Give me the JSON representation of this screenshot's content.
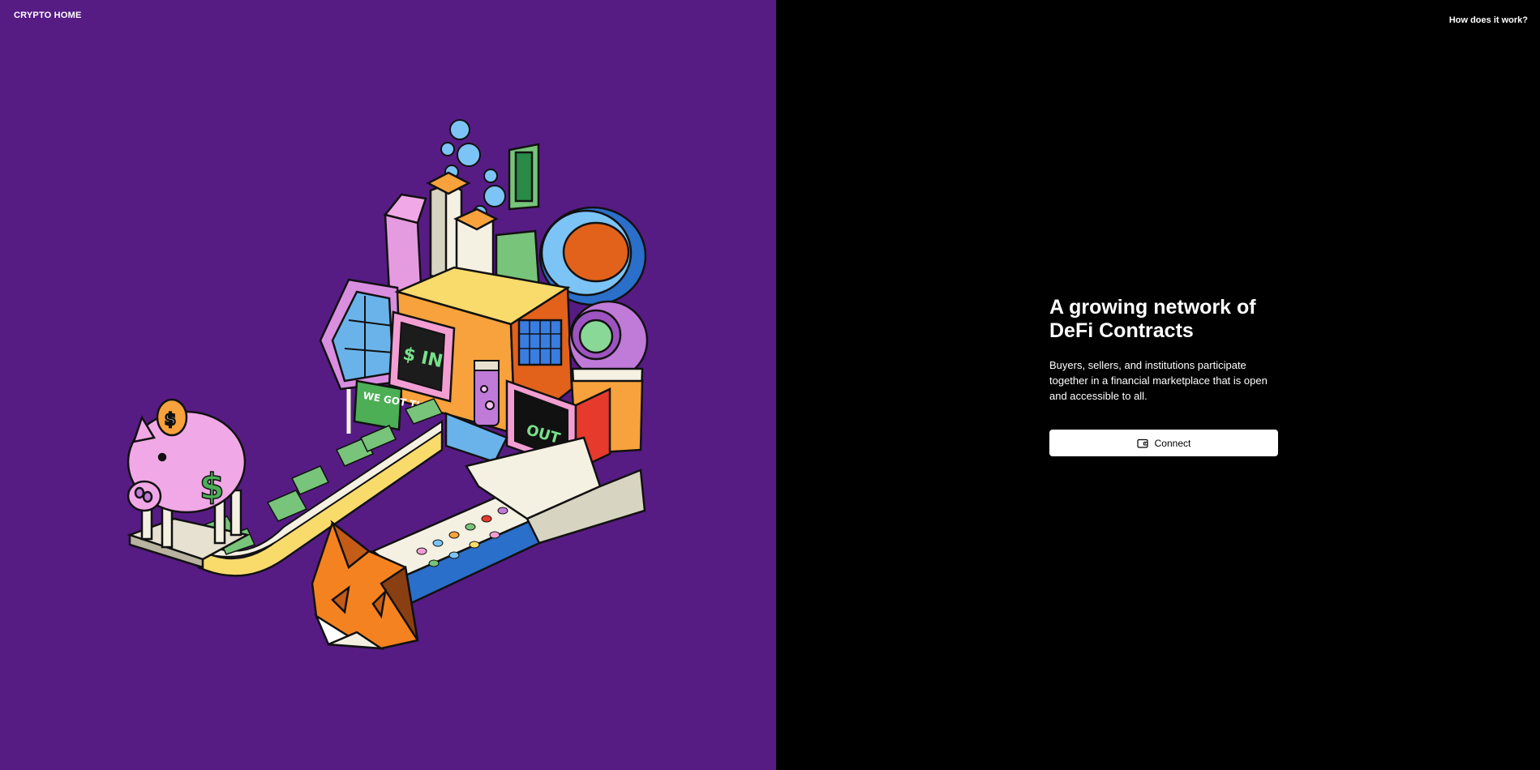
{
  "header": {
    "brand": "CRYPTO HOME",
    "help_link": "How does it work?"
  },
  "hero": {
    "title": "A growing network of DeFi Contracts",
    "description": "Buyers, sellers, and institutions participate together in a financial marketplace that is open and accessible to all.",
    "connect_label": "Connect"
  },
  "illustration": {
    "sign_in": "$ IN",
    "sign_out": "OUT",
    "banner": "WE GOT THIS",
    "coin_symbol": "$"
  },
  "colors": {
    "left_bg": "#561c84",
    "right_bg": "#000000",
    "button_bg": "#ffffff"
  }
}
